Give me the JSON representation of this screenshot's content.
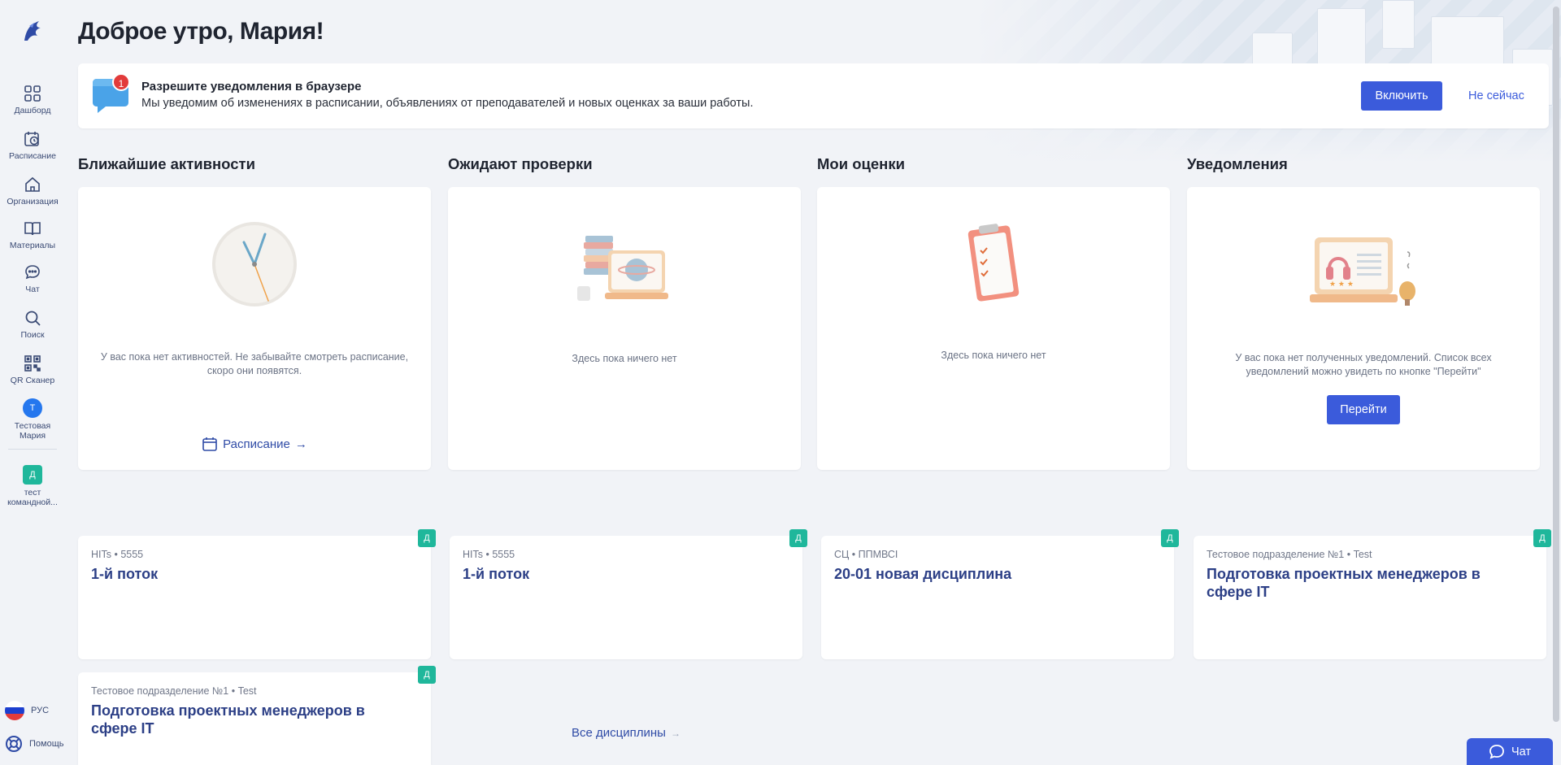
{
  "greeting": "Доброе утро, Мария!",
  "sidebar": {
    "items": [
      {
        "label": "Дашборд",
        "icon": "grid-icon"
      },
      {
        "label": "Расписание",
        "icon": "calendar-clock-icon"
      },
      {
        "label": "Организация",
        "icon": "home-icon"
      },
      {
        "label": "Материалы",
        "icon": "book-icon"
      },
      {
        "label": "Чат",
        "icon": "chat-icon"
      },
      {
        "label": "Поиск",
        "icon": "search-icon"
      },
      {
        "label": "QR Сканер",
        "icon": "qr-icon"
      }
    ],
    "user": {
      "initial": "Т",
      "name_line1": "Тестовая",
      "name_line2": "Мария"
    },
    "team": {
      "initial": "Д",
      "name_line1": "тест",
      "name_line2": "командной..."
    },
    "language": "РУС",
    "help": "Помощь"
  },
  "notify_banner": {
    "count": "1",
    "title": "Разрешите уведомления в браузере",
    "description": "Мы уведомим об изменениях в расписании, объявлениях от преподавателей и новых оценках за ваши работы.",
    "enable_label": "Включить",
    "later_label": "Не сейчас"
  },
  "widgets": {
    "activities": {
      "title": "Ближайшие активности",
      "message_line1": "У вас пока нет активностей. Не забывайте смотреть расписание,",
      "message_line2": "скоро они появятся.",
      "link": "Расписание"
    },
    "review": {
      "title": "Ожидают проверки",
      "message": "Здесь пока ничего нет"
    },
    "grades": {
      "title": "Мои оценки",
      "message": "Здесь пока ничего нет"
    },
    "notifications": {
      "title": "Уведомления",
      "message_line1": "У вас пока нет полученных уведомлений. Список всех",
      "message_line2": "уведомлений можно увидеть по кнопке \"Перейти\"",
      "button": "Перейти"
    }
  },
  "courses": [
    {
      "meta": "HITs • 5555",
      "name": "1-й поток",
      "tag": "Д"
    },
    {
      "meta": "HITs • 5555",
      "name": "1-й поток",
      "tag": "Д"
    },
    {
      "meta": "СЦ • ППМВСI",
      "name": "20-01 новая дисциплина",
      "tag": "Д"
    },
    {
      "meta": "Тестовое подразделение №1 • Test",
      "name": "Подготовка проектных менеджеров в сфере IT",
      "tag": "Д"
    },
    {
      "meta": "Тестовое подразделение №1 • Test",
      "name": "Подготовка проектных менеджеров в сфере IT",
      "tag": "Д"
    }
  ],
  "all_disciplines": "Все дисциплины",
  "chat_button": "Чат",
  "colors": {
    "primary": "#3b5bdb",
    "accent_green": "#1fb79b",
    "badge_red": "#e23b3b",
    "link": "#2f4ba6"
  }
}
